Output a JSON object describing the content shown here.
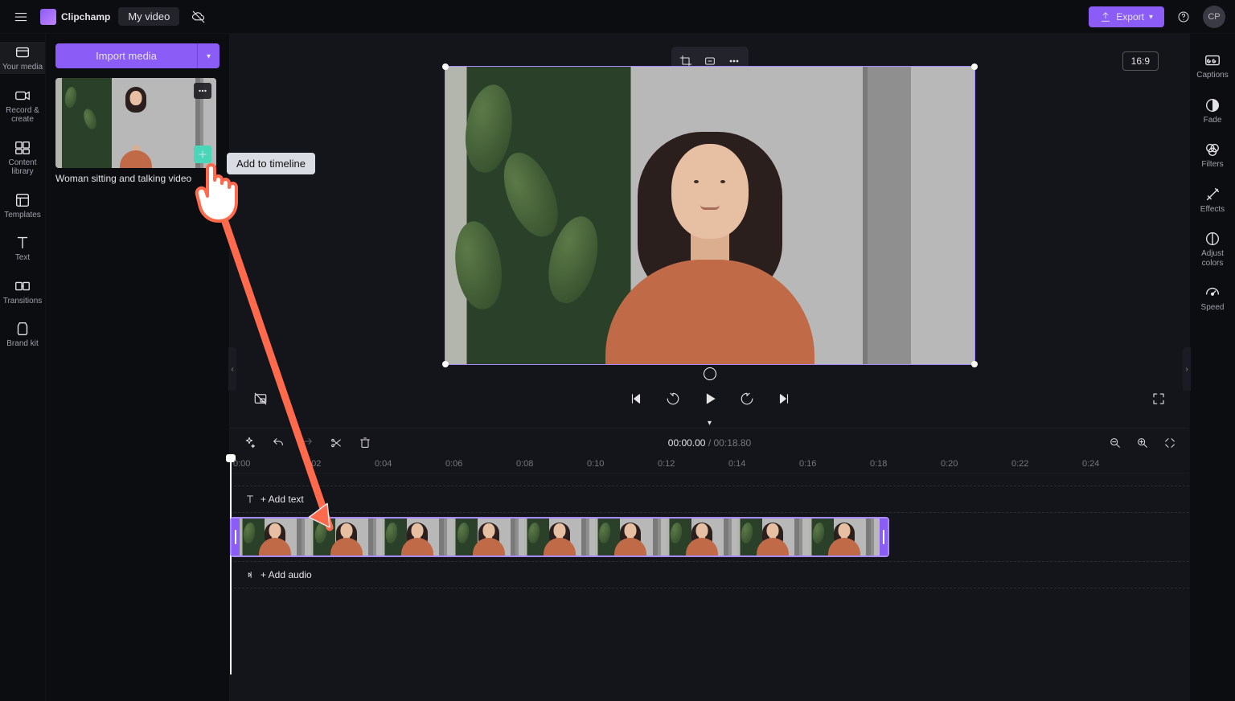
{
  "app": {
    "name": "Clipchamp",
    "project": "My video",
    "user_initials": "CP"
  },
  "header": {
    "export_label": "Export"
  },
  "left_rail": [
    {
      "id": "your-media",
      "label": "Your media"
    },
    {
      "id": "record-create",
      "label": "Record & create"
    },
    {
      "id": "content-library",
      "label": "Content library"
    },
    {
      "id": "templates",
      "label": "Templates"
    },
    {
      "id": "text",
      "label": "Text"
    },
    {
      "id": "transitions",
      "label": "Transitions"
    },
    {
      "id": "brand-kit",
      "label": "Brand kit"
    }
  ],
  "right_rail": [
    {
      "id": "captions",
      "label": "Captions"
    },
    {
      "id": "fade",
      "label": "Fade"
    },
    {
      "id": "filters",
      "label": "Filters"
    },
    {
      "id": "effects",
      "label": "Effects"
    },
    {
      "id": "adjust-colors",
      "label": "Adjust colors"
    },
    {
      "id": "speed",
      "label": "Speed"
    }
  ],
  "panel": {
    "import_label": "Import media",
    "media_caption": "Woman sitting and talking video",
    "tooltip": "Add to timeline"
  },
  "preview": {
    "aspect": "16:9"
  },
  "timeline": {
    "current": "00:00.00",
    "duration": "00:18.80",
    "ticks": [
      "0:00",
      "0:02",
      "0:04",
      "0:06",
      "0:08",
      "0:10",
      "0:12",
      "0:14",
      "0:16",
      "0:18",
      "0:20",
      "0:22",
      "0:24"
    ],
    "text_track_label": "+ Add text",
    "audio_track_label": "+ Add audio"
  },
  "colors": {
    "accent": "#8b5cf6",
    "green": "#4ad6b8",
    "annotation": "#ff6a4d"
  }
}
